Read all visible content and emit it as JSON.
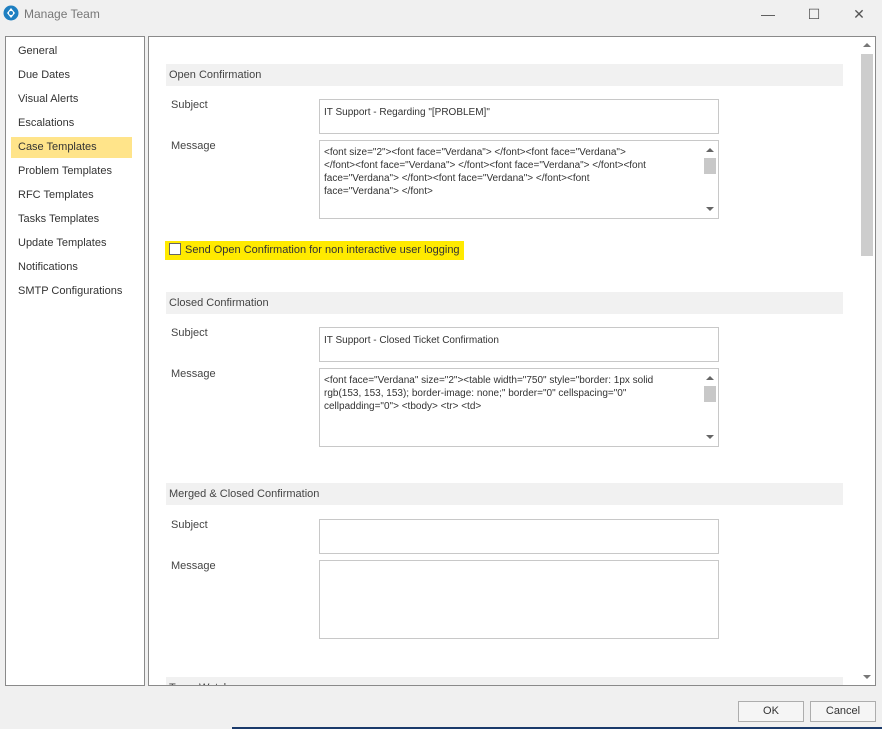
{
  "window": {
    "title": "Manage Team",
    "minimize_glyph": "—",
    "maximize_glyph": "☐",
    "close_glyph": "✕",
    "icon": "app-logo-icon",
    "accent_color": "#1e7fc1"
  },
  "sidebar": {
    "items": [
      {
        "label": "General"
      },
      {
        "label": "Due Dates"
      },
      {
        "label": "Visual Alerts"
      },
      {
        "label": "Escalations"
      },
      {
        "label": "Case Templates",
        "selected": true
      },
      {
        "label": "Problem Templates"
      },
      {
        "label": "RFC Templates"
      },
      {
        "label": "Tasks Templates"
      },
      {
        "label": "Update Templates"
      },
      {
        "label": "Notifications"
      },
      {
        "label": "SMTP Configurations"
      }
    ],
    "selected_color": "#ffe48a"
  },
  "open_confirmation": {
    "header": "Open Confirmation",
    "subject_label": "Subject",
    "subject_value": "IT Support - Regarding \"[PROBLEM]\"",
    "message_label": "Message",
    "message_value": "<font size=\"2\"><font face=\"Verdana\"> </font><font face=\"Verdana\">\n</font><font face=\"Verdana\"> </font><font face=\"Verdana\"> </font><font\nface=\"Verdana\"> </font><font face=\"Verdana\"> </font><font\nface=\"Verdana\"> </font>"
  },
  "non_interactive_checkbox": {
    "label": "Send Open Confirmation for non interactive user logging",
    "checked": false,
    "highlight_color": "#ffea00"
  },
  "closed_confirmation": {
    "header": "Closed Confirmation",
    "subject_label": "Subject",
    "subject_value": "IT Support - Closed Ticket Confirmation",
    "message_label": "Message",
    "message_value": "<font face=\"Verdana\" size=\"2\"><table width=\"750\" style=\"border: 1px solid\nrgb(153, 153, 153); border-image: none;\" border=\"0\" cellspacing=\"0\"\ncellpadding=\"0\"> <tbody> <tr> <td>"
  },
  "merged_closed_confirmation": {
    "header": "Merged & Closed Confirmation",
    "subject_label": "Subject",
    "subject_value": "",
    "message_label": "Message",
    "message_value": ""
  },
  "next_section_header": "Team Watchers",
  "footer": {
    "ok_label": "OK",
    "cancel_label": "Cancel"
  }
}
